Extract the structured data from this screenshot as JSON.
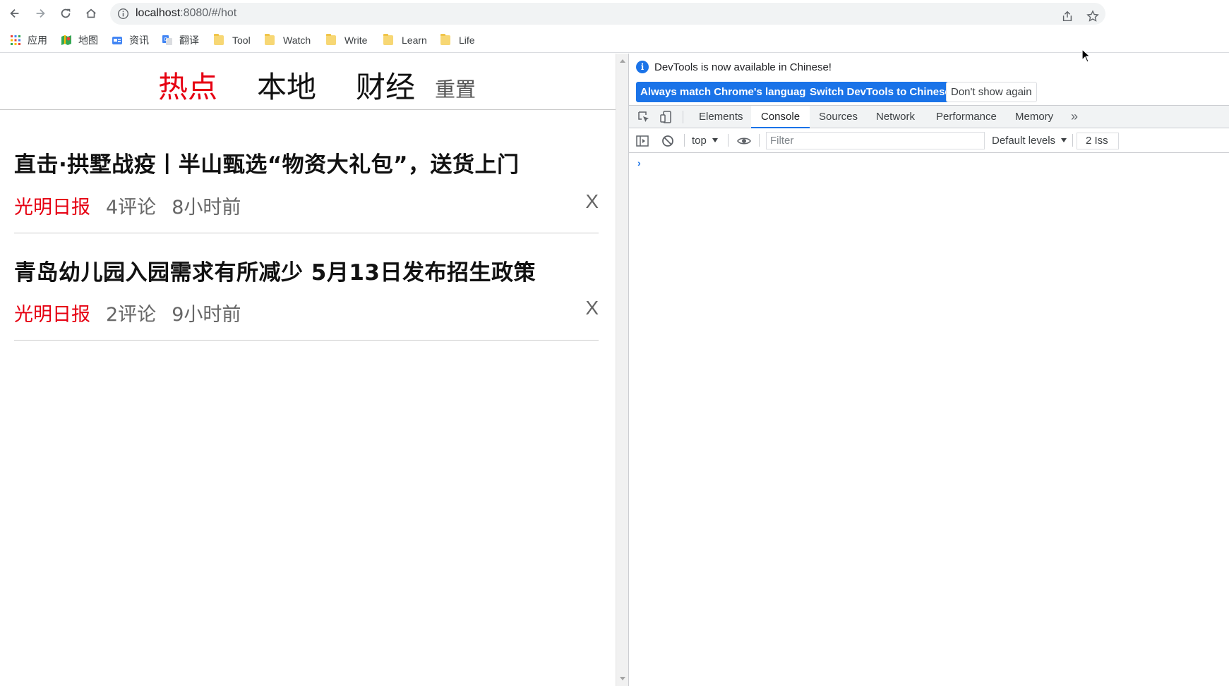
{
  "browser": {
    "url_host": "localhost",
    "url_rest": ":8080/#/hot"
  },
  "bookmarks": [
    {
      "label": "应用",
      "icon": "apps-grid-icon"
    },
    {
      "label": "地图",
      "icon": "maps-icon"
    },
    {
      "label": "资讯",
      "icon": "news-icon"
    },
    {
      "label": "翻译",
      "icon": "translate-icon"
    },
    {
      "label": "Tool",
      "icon": "folder-icon"
    },
    {
      "label": "Watch",
      "icon": "folder-icon"
    },
    {
      "label": "Write",
      "icon": "folder-icon"
    },
    {
      "label": "Learn",
      "icon": "folder-icon"
    },
    {
      "label": "Life",
      "icon": "folder-icon"
    }
  ],
  "page": {
    "tabs": [
      {
        "label": "热点",
        "active": true
      },
      {
        "label": "本地",
        "active": false
      },
      {
        "label": "财经",
        "active": false
      }
    ],
    "reset_label": "重置",
    "news": [
      {
        "title": "直击·拱墅战疫丨半山甄选“物资大礼包”，送货上门",
        "source": "光明日报",
        "comments": "4评论",
        "time": "8小时前",
        "close": "X"
      },
      {
        "title": "青岛幼儿园入园需求有所减少 5月13日发布招生政策",
        "source": "光明日报",
        "comments": "2评论",
        "time": "9小时前",
        "close": "X"
      }
    ]
  },
  "devtools": {
    "info_message": "DevTools is now available in Chinese!",
    "btn_match": "Always match Chrome's language",
    "btn_switch": "Switch DevTools to Chinese",
    "btn_dont_show": "Don't show again",
    "tabs": [
      "Elements",
      "Console",
      "Sources",
      "Network",
      "Performance",
      "Memory"
    ],
    "active_tab": "Console",
    "context": "top",
    "filter_placeholder": "Filter",
    "levels": "Default levels",
    "issues": "2 Iss",
    "prompt": "›"
  },
  "colors": {
    "accent_red": "#e60012",
    "devtools_blue": "#1a73e8"
  }
}
